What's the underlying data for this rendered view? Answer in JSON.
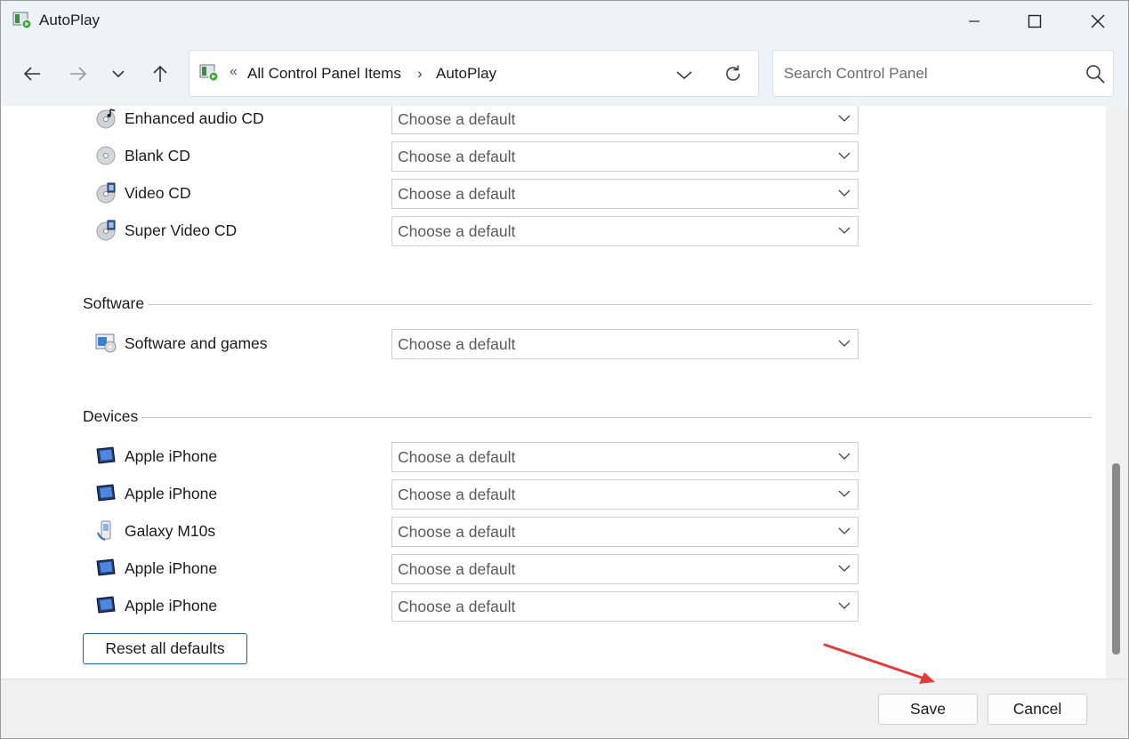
{
  "window": {
    "title": "AutoPlay",
    "icon": "autoplay-icon",
    "controls": [
      "minimize-icon",
      "maximize-icon",
      "close-icon"
    ]
  },
  "nav": {
    "back_icon": "arrow-left-icon",
    "forward_icon": "arrow-right-icon",
    "recent_icon": "chevron-down-icon",
    "up_icon": "arrow-up-icon",
    "address": {
      "overflow": "«",
      "crumbs": [
        "All Control Panel Items",
        "AutoPlay"
      ],
      "separator": "›"
    },
    "search": {
      "placeholder": "Search Control Panel",
      "value": ""
    }
  },
  "content": {
    "media_rows": [
      {
        "label": "Enhanced audio CD",
        "icon": "enhanced-audio-cd-icon",
        "value": "Choose a default"
      },
      {
        "label": "Blank CD",
        "icon": "blank-cd-icon",
        "value": "Choose a default"
      },
      {
        "label": "Video CD",
        "icon": "video-cd-icon",
        "value": "Choose a default"
      },
      {
        "label": "Super Video CD",
        "icon": "super-video-cd-icon",
        "value": "Choose a default"
      }
    ],
    "software": {
      "title": "Software",
      "rows": [
        {
          "label": "Software and games",
          "icon": "software-games-icon",
          "value": "Choose a default"
        }
      ]
    },
    "devices": {
      "title": "Devices",
      "rows": [
        {
          "label": "Apple iPhone",
          "icon": "device-icon",
          "value": "Choose a default"
        },
        {
          "label": "Apple iPhone",
          "icon": "device-icon",
          "value": "Choose a default"
        },
        {
          "label": "Galaxy M10s",
          "icon": "phone-icon",
          "value": "Choose a default"
        },
        {
          "label": "Apple iPhone",
          "icon": "device-icon",
          "value": "Choose a default"
        },
        {
          "label": "Apple iPhone",
          "icon": "device-icon",
          "value": "Choose a default"
        }
      ]
    },
    "reset_label": "Reset all defaults"
  },
  "footer": {
    "save_label": "Save",
    "cancel_label": "Cancel"
  },
  "colors": {
    "titlebar_bg": "#eef3f9",
    "accent_border": "#1f5f9c",
    "annotation_arrow": "#e03c3c"
  }
}
